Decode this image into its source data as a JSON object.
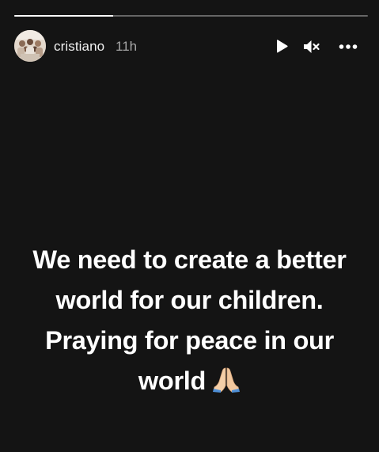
{
  "story": {
    "progress_fraction": 0.28,
    "user": {
      "username": "cristiano",
      "time_ago": "11h",
      "avatar_icon": "profile-photo-avatar"
    },
    "controls": {
      "play_icon": "play-icon",
      "mute_icon": "speaker-muted-icon",
      "more_icon": "more-options-icon"
    },
    "caption_lines": [
      "We need to create a better",
      "world for our children.",
      "Praying for peace in our",
      "world"
    ],
    "caption_emoji": "folded-hands-icon",
    "colors": {
      "background": "#141414",
      "text": "#ffffff",
      "muted_text": "#a8a8a8",
      "emoji_skin": "#f4cfa8"
    }
  }
}
